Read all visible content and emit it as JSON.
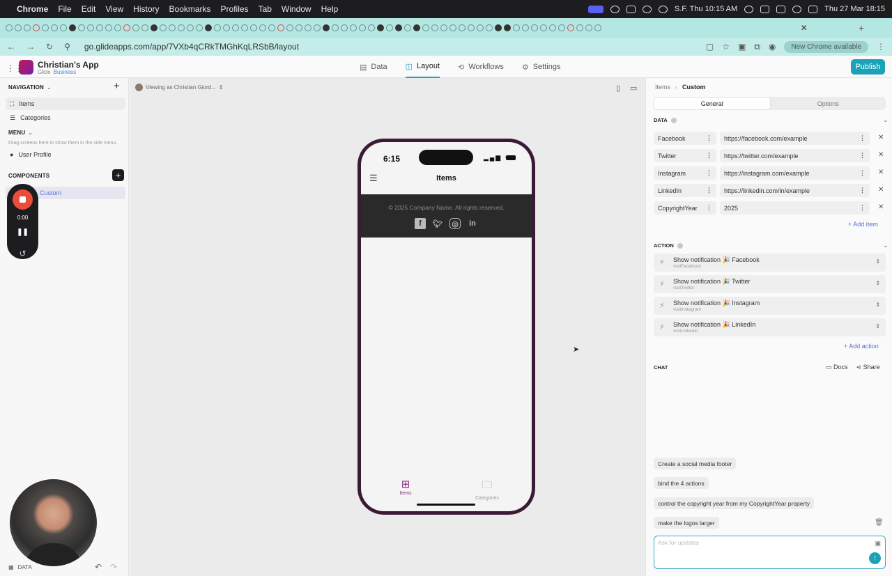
{
  "menubar": {
    "app": "Chrome",
    "items": [
      "File",
      "Edit",
      "View",
      "History",
      "Bookmarks",
      "Profiles",
      "Tab",
      "Window",
      "Help"
    ],
    "clock_city": "S.F. Thu 10:15 AM",
    "datetime": "Thu 27 Mar  18:15"
  },
  "browser": {
    "url": "go.glideapps.com/app/7VXb4qCRkTMGhKqLRSbB/layout",
    "update_pill": "New Chrome available"
  },
  "header": {
    "app_name": "Christian's App",
    "workspace": "Glide",
    "plan": "Business",
    "tabs": [
      {
        "label": "Data",
        "icon": "table-icon"
      },
      {
        "label": "Layout",
        "icon": "layout-icon"
      },
      {
        "label": "Workflows",
        "icon": "workflow-icon"
      },
      {
        "label": "Settings",
        "icon": "gear-icon"
      }
    ],
    "active_tab": "Layout",
    "publish": "Publish"
  },
  "left": {
    "navigation_title": "NAVIGATION",
    "nav_items": [
      "Items",
      "Categories"
    ],
    "menu_title": "MENU",
    "menu_hint": "Drag screens here to show them in the side menu.",
    "menu_items": [
      "User Profile"
    ],
    "components_title": "COMPONENTS",
    "component_items": [
      "Custom"
    ],
    "recorder_time": "0:00",
    "bottom_label": "DATA"
  },
  "canvas": {
    "viewing_as": "Viewing as Christian Giord..."
  },
  "phone": {
    "time": "6:15",
    "title": "Items",
    "copyright": "© 2025 Company Name. All rights reserved.",
    "social_icons": [
      "facebook-icon",
      "twitter-icon",
      "instagram-icon",
      "linkedin-icon"
    ],
    "bottom_nav": [
      {
        "label": "Items",
        "active": true
      },
      {
        "label": "Categories",
        "active": false
      }
    ],
    "accent_color": "#8a2a82"
  },
  "right": {
    "breadcrumb": [
      "Items",
      "Custom"
    ],
    "segments": [
      "General",
      "Options"
    ],
    "active_segment": "General",
    "data_title": "DATA",
    "data_rows": [
      {
        "key": "Facebook",
        "value": "https://facebook.com/example"
      },
      {
        "key": "Twitter",
        "value": "https://twitter.com/example"
      },
      {
        "key": "Instagram",
        "value": "https://instagram.com/example"
      },
      {
        "key": "LinkedIn",
        "value": "https://linkedin.com/in/example"
      },
      {
        "key": "CopyrightYear",
        "value": "2025"
      }
    ],
    "add_item": "Add item",
    "action_title": "ACTION",
    "actions": [
      {
        "label": "Show notification 🎉 Facebook",
        "sub": "visitFacebook"
      },
      {
        "label": "Show notification 🎉 Twitter",
        "sub": "visitTwitter"
      },
      {
        "label": "Show notification 🎉 Instagram",
        "sub": "visitInstagram"
      },
      {
        "label": "Show notification 🎉 LinkedIn",
        "sub": "visitLinkedIn"
      }
    ],
    "add_action": "Add action",
    "chat_title": "CHAT",
    "docs": "Docs",
    "share": "Share",
    "chat_messages": [
      "Create a social media footer",
      "bind the 4 actions",
      "control the copyright year from my CopyrightYear property",
      "make the logos larger"
    ],
    "ask_placeholder": "Ask for updates",
    "brand_color": "#1aa3b8"
  }
}
